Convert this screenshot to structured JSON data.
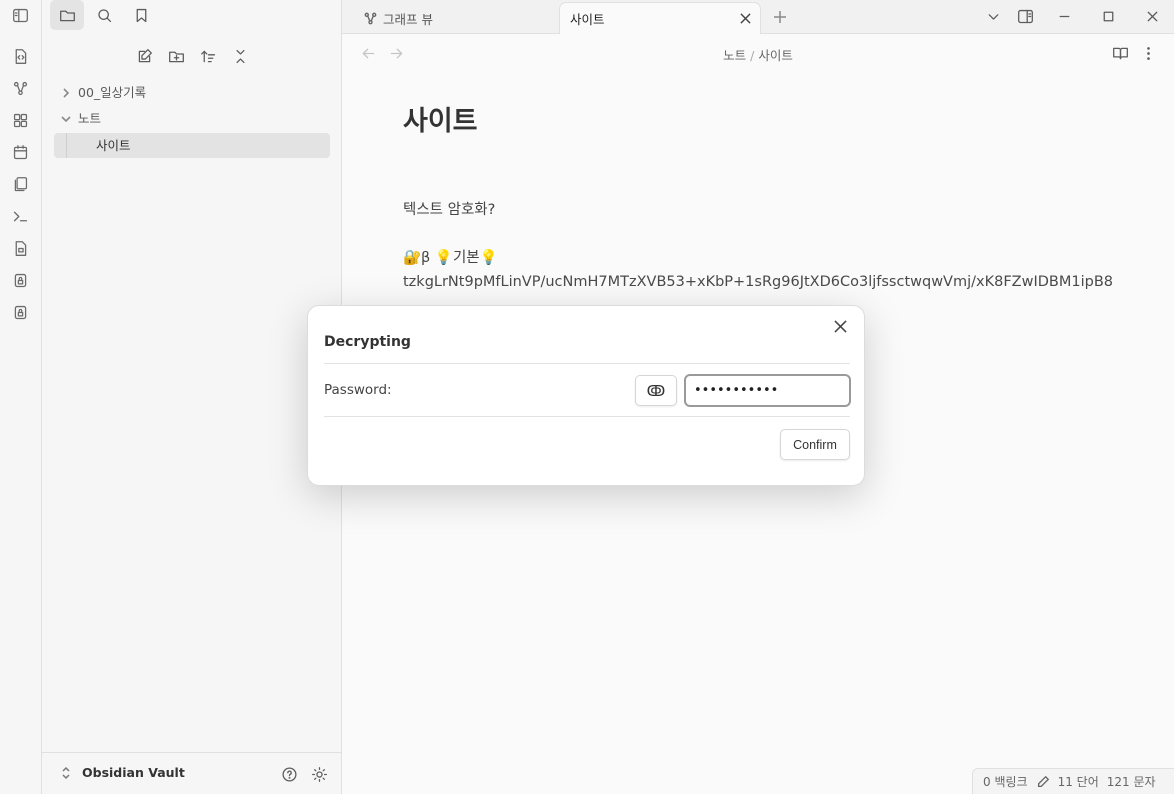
{
  "sidebar": {
    "tree": [
      {
        "label": "00_일상기록",
        "expanded": false
      },
      {
        "label": "노트",
        "expanded": true
      }
    ],
    "active_file": "사이트",
    "vault_name": "Obsidian Vault"
  },
  "tabs": [
    {
      "label": "그래프 뷰",
      "icon": "graph-icon",
      "active": false
    },
    {
      "label": "사이트",
      "icon": "",
      "active": true
    }
  ],
  "breadcrumb": {
    "folder": "노트",
    "file": "사이트",
    "separator": "/"
  },
  "note": {
    "title": "사이트",
    "line1": "텍스트 암호화?",
    "line2": "🔐β 💡기본💡",
    "cipher": "tzkgLrNt9pMfLinVP/ucNmH7MTzXVB53+xKbP+1sRg96JtXD6Co3ljfssctwqwVmj/xK8FZwIDBM1ipB8"
  },
  "modal": {
    "title": "Decrypting",
    "password_label": "Password:",
    "reveal_glyph": "ↂ",
    "password_value": "•••••••••••",
    "confirm_label": "Confirm"
  },
  "status_bar": {
    "backlinks": "0 백링크",
    "words": "11 단어",
    "chars": "121 문자"
  }
}
